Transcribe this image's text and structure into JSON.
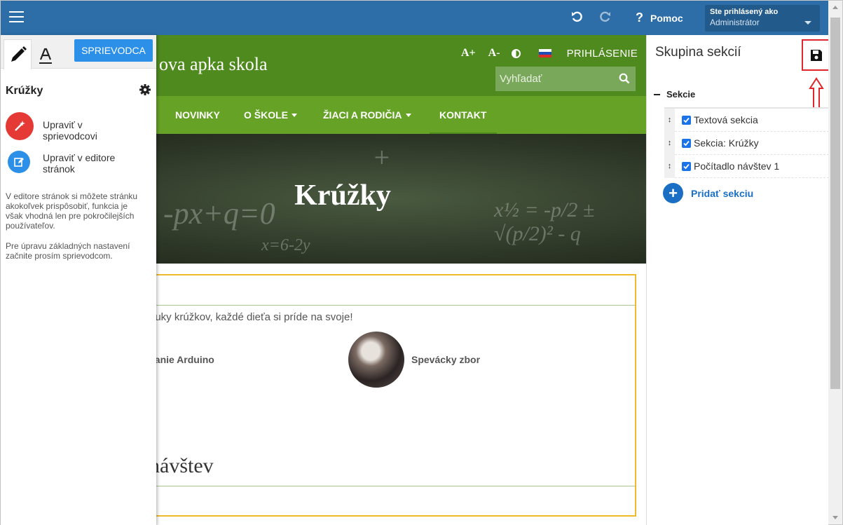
{
  "topbar": {
    "help_label": "Pomoc",
    "user_line1": "Ste prihlásený ako",
    "user_line2": "Administrátor"
  },
  "site": {
    "title": "ova apka skola",
    "font_plus": "A+",
    "font_minus": "A-",
    "login": "PRIHLÁSENIE",
    "search_placeholder": "Vyhľadať",
    "nav": [
      "NOVINKY",
      "O ŠKOLE",
      "ŽIACI A RODIČIA",
      "KONTAKT"
    ],
    "hero_title": "Krúžky",
    "intro_text": "nuky krúžkov, každé dieťa si príde na svoje!",
    "item1": "vanie Arduino",
    "item2": "Spevácky zbor",
    "section_heading": "návštev"
  },
  "left_panel": {
    "guide_button": "SPRIEVODCA",
    "title": "Krúžky",
    "action1": "Upraviť v sprievodcovi",
    "action2": "Upraviť v editore stránok",
    "desc1": "V editore stránok si môžete stránku akokoľvek prispôsobiť, funkcia je však vhodná len pre pokročilejších používateľov.",
    "desc2": "Pre úpravu základných nastavení začnite prosím sprievodcom."
  },
  "right_panel": {
    "title": "Skupina sekcií",
    "group_label": "Sekcie",
    "sections": [
      {
        "label": "Textová sekcia",
        "checked": true
      },
      {
        "label": "Sekcia: Krúžky",
        "checked": true
      },
      {
        "label": "Počítadlo návštev 1",
        "checked": true
      }
    ],
    "add_section": "Pridať sekciu"
  },
  "colors": {
    "topbar": "#2d6ea8",
    "site_header": "#4f8a1e",
    "site_nav": "#66a226",
    "accent_blue": "#2d90e8",
    "highlight_red": "#e0262d",
    "section_border": "#f0b92a"
  }
}
